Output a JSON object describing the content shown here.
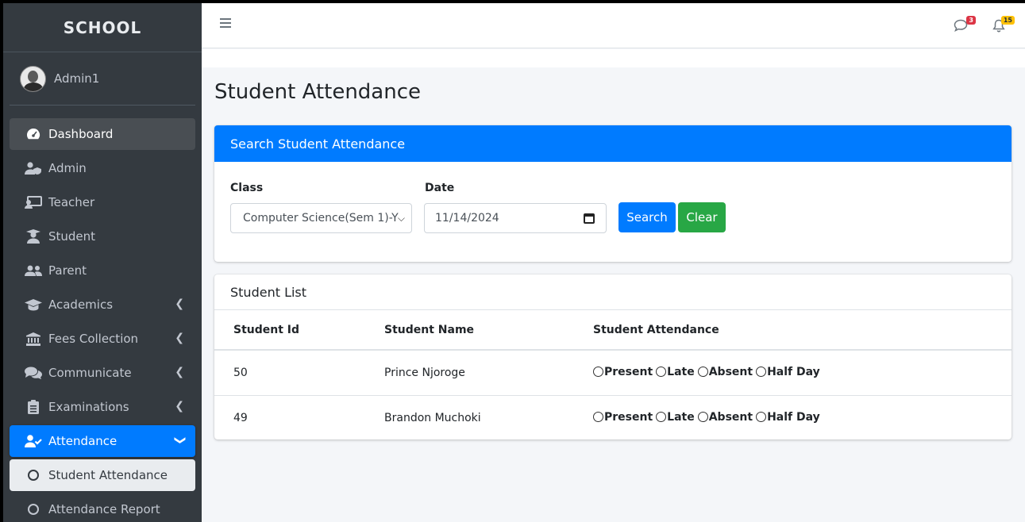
{
  "brand": "SCHOOL",
  "user": {
    "name": "Admin1"
  },
  "sidebar": {
    "items": [
      {
        "label": "Dashboard",
        "icon": "dashboard-icon"
      },
      {
        "label": "Admin",
        "icon": "user-shield-icon"
      },
      {
        "label": "Teacher",
        "icon": "chalkboard-teacher-icon"
      },
      {
        "label": "Student",
        "icon": "user-graduate-icon"
      },
      {
        "label": "Parent",
        "icon": "users-icon"
      },
      {
        "label": "Academics",
        "icon": "graduation-cap-icon"
      },
      {
        "label": "Fees Collection",
        "icon": "university-icon"
      },
      {
        "label": "Communicate",
        "icon": "comments-icon"
      },
      {
        "label": "Examinations",
        "icon": "clipboard-icon"
      },
      {
        "label": "Attendance",
        "icon": "user-check-icon"
      },
      {
        "label": "Student Attendance",
        "icon": "circle-icon"
      },
      {
        "label": "Attendance Report",
        "icon": "circle-icon"
      }
    ]
  },
  "topbar": {
    "messages_count": "3",
    "notifications_count": "15"
  },
  "page": {
    "title": "Student Attendance"
  },
  "search_card": {
    "header": "Search Student Attendance",
    "class_label": "Class",
    "class_value": "Computer Science(Sem 1)-Y",
    "date_label": "Date",
    "date_value": "11/14/2024",
    "search_button": "Search",
    "clear_button": "Clear"
  },
  "list_card": {
    "title": "Student List",
    "columns": [
      "Student Id",
      "Student Name",
      "Student Attendance"
    ],
    "options": [
      "Present",
      "Late",
      "Absent",
      "Half Day"
    ],
    "rows": [
      {
        "id": "50",
        "name": "Prince Njoroge"
      },
      {
        "id": "49",
        "name": "Brandon Muchoki"
      }
    ]
  },
  "colors": {
    "sidebar_bg": "#343a40",
    "primary": "#007bff",
    "success": "#28a745",
    "danger": "#dc3545",
    "warning": "#ffc107"
  }
}
